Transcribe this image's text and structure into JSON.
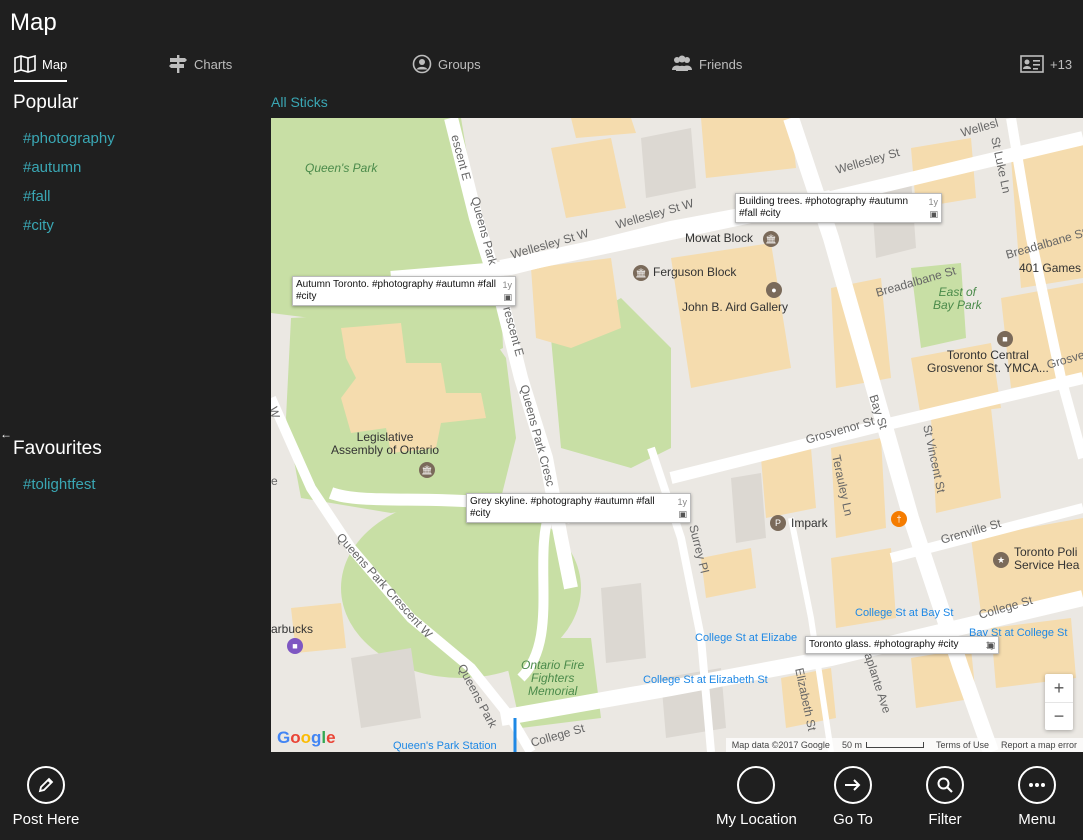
{
  "app": {
    "title": "Map"
  },
  "tabs": {
    "map": "Map",
    "charts": "Charts",
    "groups": "Groups",
    "friends": "Friends",
    "more": "+13"
  },
  "sidebar": {
    "popular_title": "Popular",
    "popular_tags": [
      "#photography",
      "#autumn",
      "#fall",
      "#city"
    ],
    "favourites_title": "Favourites",
    "favourite_tags": [
      "#tolightfest"
    ]
  },
  "map": {
    "filter_label": "All Sticks",
    "places": {
      "queens_park": "Queen's Park",
      "mowat_block": "Mowat Block",
      "ferguson_block": "Ferguson Block",
      "aird_gallery": "John B. Aird Gallery",
      "legislative": "Legislative\nAssembly of Ontario",
      "east_bay_park": "East of\nBay Park",
      "ymca": "Toronto Central\nGrosvenor St. YMCA...",
      "games": "401 Games",
      "impark": "Impark",
      "toronto_police": "Toronto Poli\nService Hea",
      "starbucks": "arbucks",
      "fire_memorial": "Ontario Fire\nFighters\nMemorial"
    },
    "streets": {
      "wellesley_w1": "Wellesley St W",
      "wellesley_w2": "Wellesley St W",
      "wellesley": "Wellesley St",
      "wellesley_top": "Wellesl",
      "breadalbane1": "Breadalbane St",
      "breadalbane2": "Breadalbane St",
      "grosvenor": "Grosvenor St",
      "grosvenor_right": "Grosve",
      "grenville": "Grenville St",
      "college": "College St",
      "college_right": "College St",
      "bay": "Bay St",
      "st_vincent": "St Vincent St",
      "st_luke": "St Luke Ln",
      "surrey": "Surrey Pl",
      "terauley": "Terauley Ln",
      "laplante": "Laplante Ave",
      "elizabeth": "Elizabeth St",
      "queens_park_cres_e1": "Queens Park Cresc",
      "queens_park_cres_e2": "escent E",
      "queens_park_cres_e3": "Queens Park",
      "queens_park_cres_e4": "rescent E",
      "queens_park_cres_w": "Queens Park Crescent W",
      "queens_park_bottom": "Queens Park",
      "cres_left": "W",
      "e_left": "e",
      "yonge": "Yo"
    },
    "transit": {
      "college_bay1": "College St at Bay St",
      "college_bay2": "Bay St at College St",
      "college_eliz1": "College St at Elizabe",
      "college_eliz2": "College St at Elizabeth St",
      "queens_park_station": "Queen's Park Station"
    },
    "popups": [
      {
        "text": "Building trees. #photography #autumn #fall #city",
        "age": "1y",
        "icon": "camera-icon"
      },
      {
        "text": "Autumn Toronto. #photography #autumn #fall #city",
        "age": "1y",
        "icon": "camera-icon"
      },
      {
        "text": "Grey skyline. #photography #autumn #fall #city",
        "age": "1y",
        "icon": "camera-icon"
      },
      {
        "text": "Toronto glass. #photography #city",
        "age": "1y",
        "icon": "camera-icon"
      }
    ],
    "zoom_in": "+",
    "zoom_out": "−",
    "google": "Google",
    "attribution": {
      "data": "Map data ©2017 Google",
      "scale": "50 m",
      "terms": "Terms of Use",
      "report": "Report a map error"
    }
  },
  "bottom_actions": {
    "post": "Post Here",
    "location": "My Location",
    "goto": "Go To",
    "filter": "Filter",
    "menu": "Menu"
  },
  "colors": {
    "accent": "#3aa7b4",
    "background": "#1f1f1f",
    "park": "#c8dfa5",
    "building": "#f5dcae",
    "road": "#ffffff",
    "map_base": "#ebe8e3"
  }
}
